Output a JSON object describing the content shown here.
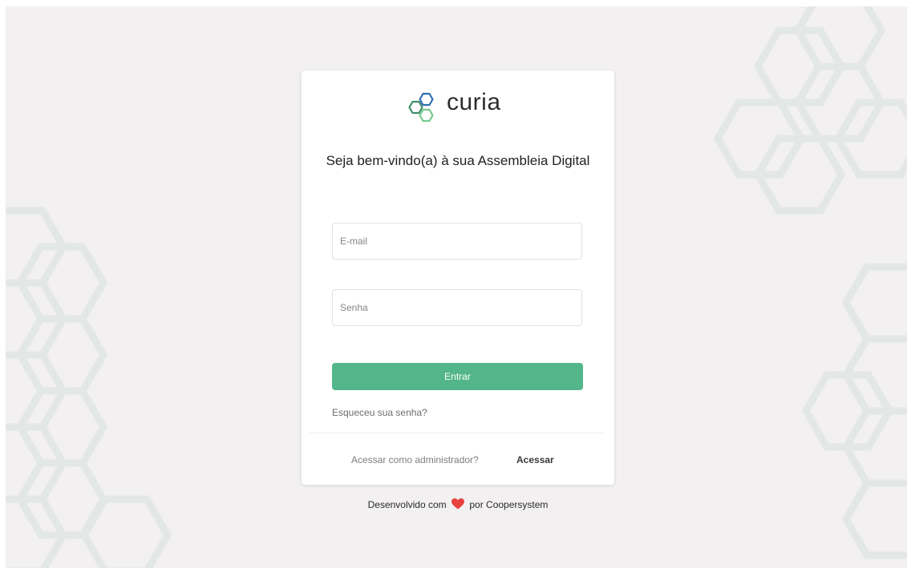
{
  "brand": {
    "name": "curia",
    "accent_color": "#52b68a",
    "logo_icon": "hexagon-logo-icon"
  },
  "login": {
    "welcome": "Seja bem-vindo(a) à sua Assembleia Digital",
    "email_placeholder": "E-mail",
    "password_placeholder": "Senha",
    "submit_label": "Entrar",
    "forgot_label": "Esqueceu sua senha?",
    "admin_prompt": "Acessar como administrador?",
    "admin_link": "Acessar"
  },
  "footer": {
    "prefix": "Desenvolvido com",
    "heart_icon": "heart-icon",
    "suffix": "por Coopersystem"
  }
}
